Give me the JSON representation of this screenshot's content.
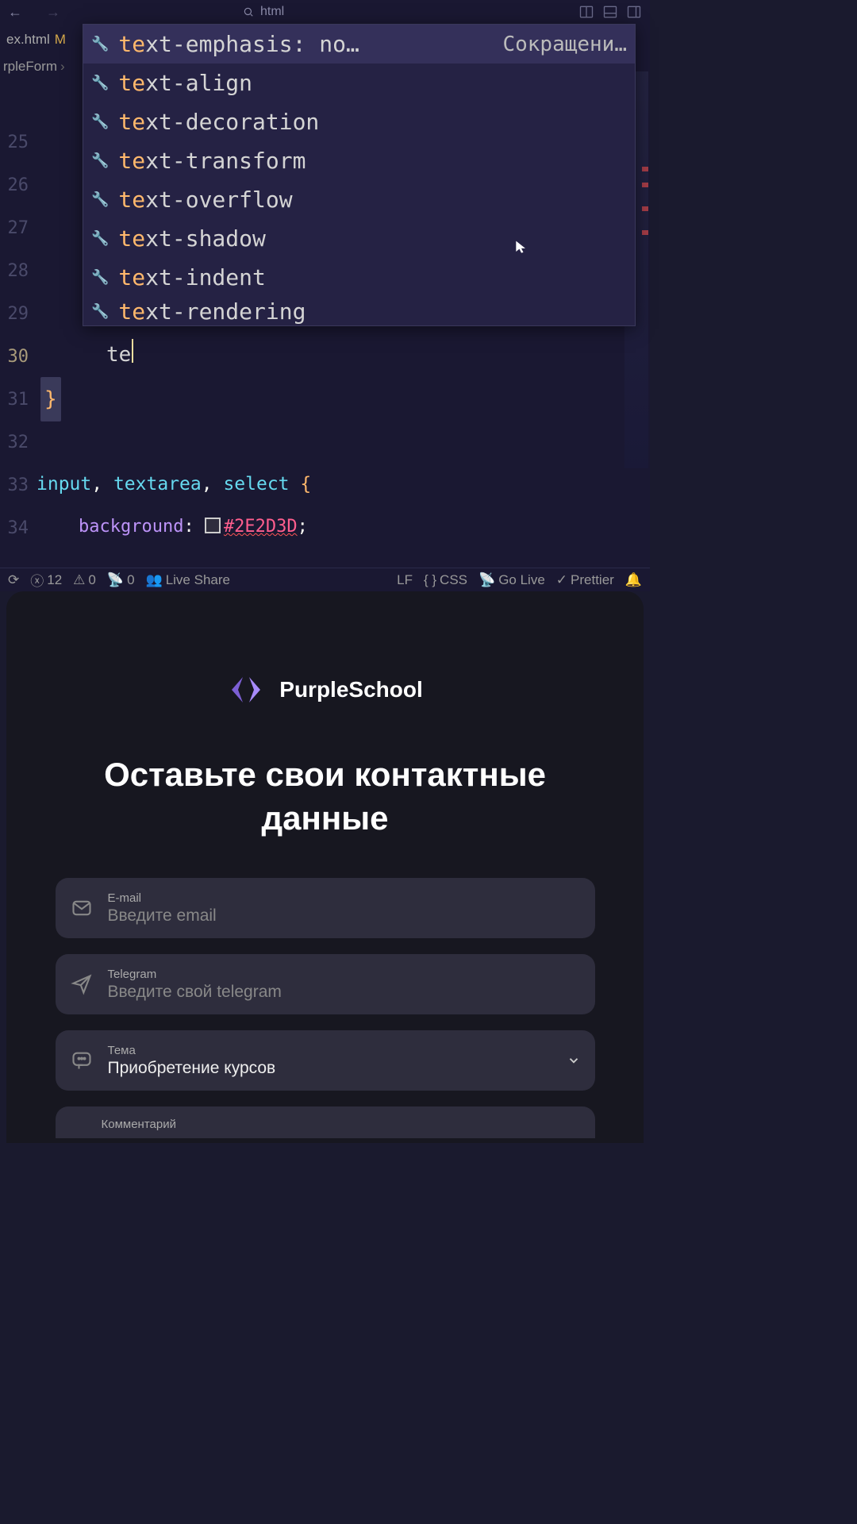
{
  "topbar": {
    "search_text": "html"
  },
  "tab": {
    "filename": "ex.html",
    "modified_marker": "M"
  },
  "breadcrumb": {
    "item1": "rpleForm",
    "sep": "›"
  },
  "gutter_lines": [
    "25",
    "26",
    "27",
    "28",
    "29",
    "30",
    "31",
    "32",
    "33",
    "34"
  ],
  "autocomplete": {
    "match_prefix": "te",
    "items": [
      {
        "rest": "xt-emphasis",
        "preview": ": no…",
        "hint": "Сокращени…",
        "selected": true
      },
      {
        "rest": "xt-align"
      },
      {
        "rest": "xt-decoration"
      },
      {
        "rest": "xt-transform"
      },
      {
        "rest": "xt-overflow"
      },
      {
        "rest": "xt-shadow"
      },
      {
        "rest": "xt-indent"
      },
      {
        "rest": "xt-rendering"
      }
    ]
  },
  "typed_text": "te",
  "brace_close": "}",
  "line33": {
    "t1": "input",
    "c1": ", ",
    "t2": "textarea",
    "c2": ", ",
    "t3": "select",
    "sp": " ",
    "brace": "{"
  },
  "line34": {
    "indent": "    ",
    "prop": "background",
    "colon": ": ",
    "val": "#2E2D3D",
    "semi": ";"
  },
  "statusbar": {
    "errors": "12",
    "warnings": "0",
    "radio": "0",
    "liveshare": "Live Share",
    "lf": "LF",
    "lang": "CSS",
    "golive": "Go Live",
    "prettier": "Prettier"
  },
  "preview": {
    "brand": "PurpleSchool",
    "title": "Оставьте свои контактные данные",
    "fields": {
      "email": {
        "label": "E-mail",
        "placeholder": "Введите email"
      },
      "telegram": {
        "label": "Telegram",
        "placeholder": "Введите свой telegram"
      },
      "topic": {
        "label": "Тема",
        "value": "Приобретение курсов"
      },
      "comment": {
        "label": "Комментарий"
      }
    }
  }
}
